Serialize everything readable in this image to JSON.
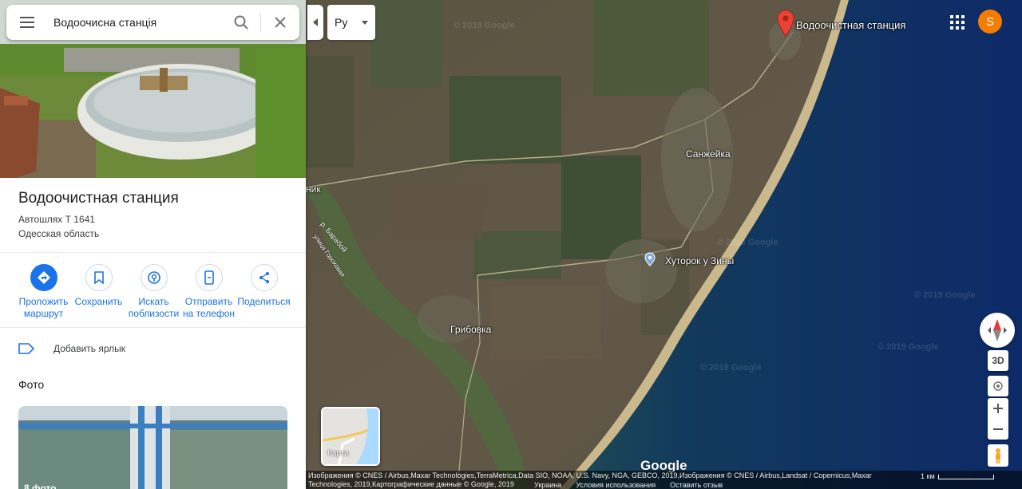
{
  "search": {
    "query": "Водоочисна станція"
  },
  "language": {
    "value": "Ру"
  },
  "place": {
    "title": "Водоочистная станция",
    "address_line1": "Автошлях Т 1641",
    "address_line2": "Одесская область"
  },
  "actions": [
    {
      "label": "Проложить\nмаршрут",
      "icon": "directions-icon"
    },
    {
      "label": "Сохранить",
      "icon": "bookmark-icon"
    },
    {
      "label": "Искать\nпоблизости",
      "icon": "nearby-icon"
    },
    {
      "label": "Отправить\nна телефон",
      "icon": "phone-icon"
    },
    {
      "label": "Поделиться",
      "icon": "share-icon"
    }
  ],
  "add_label": "Добавить ярлык",
  "photos": {
    "heading": "Фото",
    "count": "8 фото"
  },
  "map": {
    "marker_label": "Водоочистная станция",
    "places": {
      "sanzheyka": "Санжейка",
      "khutorok": "Хуторок у Зины",
      "gribovka": "Грибовка",
      "nik": "ник"
    },
    "roads": {
      "baraboy": "р. Барабой",
      "gorodskaya": "улица Гороховая"
    },
    "watermark": "© 2019 Google",
    "minimap_label": "Карта",
    "logo": "Google",
    "threed": "3D"
  },
  "footer": {
    "attribution": "Изображения © CNES / Airbus,Maxar Technologies,TerraMetrica,Data SIO, NOAA, U.S. Navy, NGA, GEBCO, 2019,Изображения © CNES / Airbus,Landsat / Copernicus,Maxar Technologies, 2019,Картографические данные © Google, 2019",
    "links": [
      "Украина",
      "Условия использования",
      "Оставить отзыв"
    ],
    "scale": "1 км"
  },
  "colors": {
    "accent": "#1a73e8",
    "avatar": "#f57c00",
    "marker": "#ea4335"
  },
  "user": {
    "initial": "S"
  }
}
